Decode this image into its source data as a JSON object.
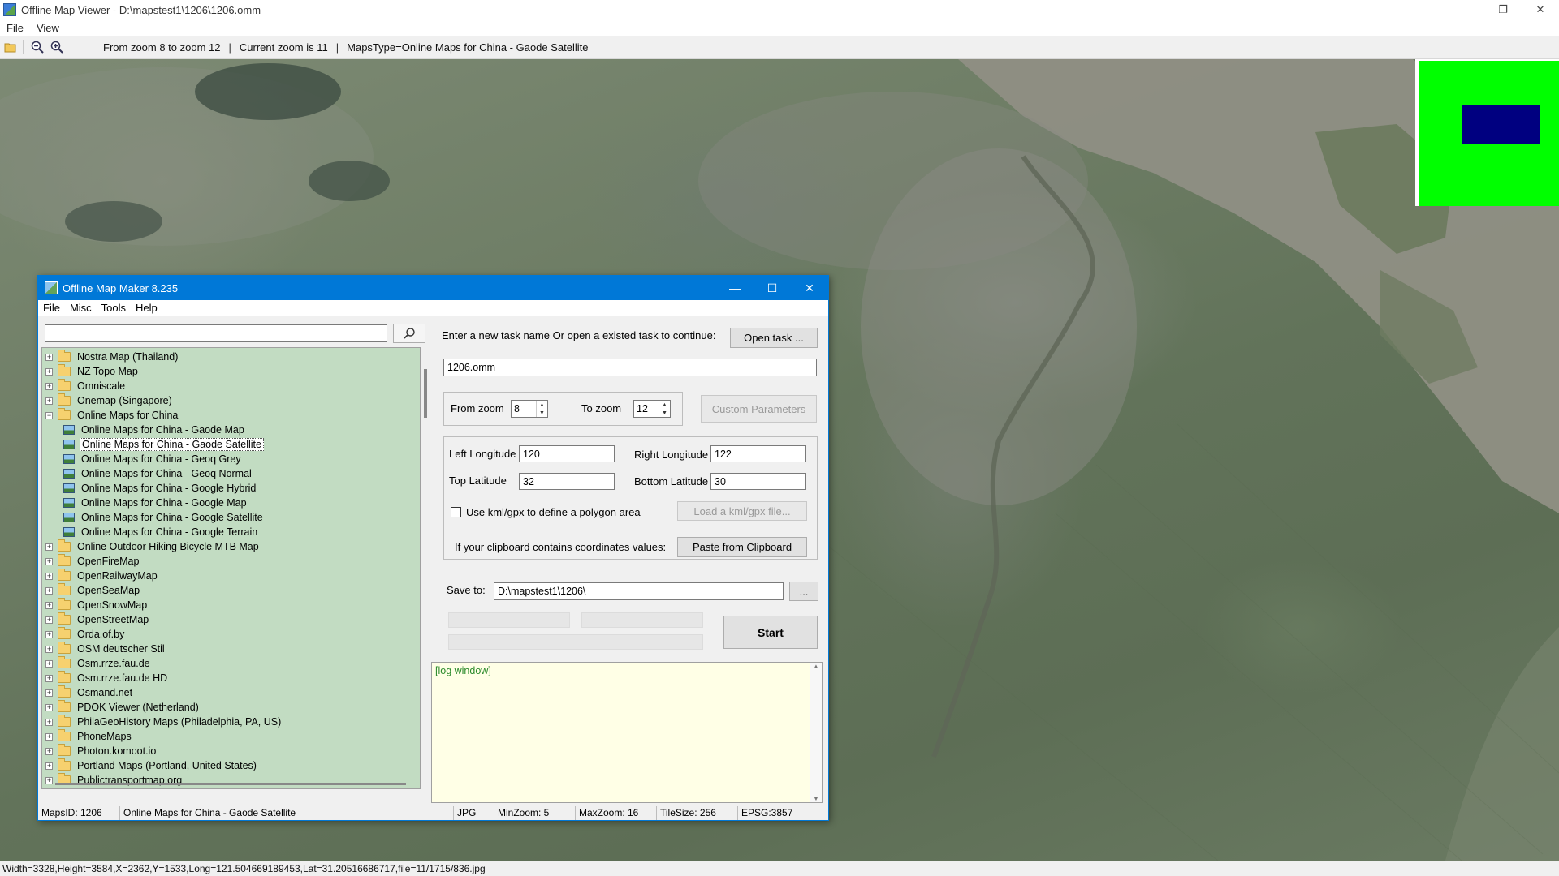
{
  "viewer": {
    "title": "Offline Map Viewer - D:\\mapstest1\\1206\\1206.omm",
    "menu": [
      "File",
      "View"
    ],
    "toolbar": {
      "zoom_range": "From zoom 8 to zoom 12",
      "current_zoom": "Current zoom is 11",
      "maps_type": "MapsType=Online Maps for China - Gaode Satellite"
    },
    "status": "Width=3328,Height=3584,X=2362,Y=1533,Long=121.504669189453,Lat=31.20516686717,file=11/1715/836.jpg",
    "overview_colors": {
      "background": "#00ff00",
      "viewport": "#000080"
    }
  },
  "maker": {
    "title": "Offline Map Maker 8.235",
    "menu": [
      "File",
      "Misc",
      "Tools",
      "Help"
    ],
    "search": {
      "value": "",
      "placeholder": ""
    },
    "tree": [
      {
        "label": "Nostra Map (Thailand)",
        "level": 0,
        "type": "folder",
        "expanded": false
      },
      {
        "label": "NZ Topo Map",
        "level": 0,
        "type": "folder",
        "expanded": false
      },
      {
        "label": "Omniscale",
        "level": 0,
        "type": "folder",
        "expanded": false
      },
      {
        "label": "Onemap (Singapore)",
        "level": 0,
        "type": "folder",
        "expanded": false
      },
      {
        "label": "Online Maps for China",
        "level": 0,
        "type": "folder",
        "expanded": true
      },
      {
        "label": "Online Maps for China - Gaode Map",
        "level": 1,
        "type": "map"
      },
      {
        "label": "Online Maps for China - Gaode Satellite",
        "level": 1,
        "type": "map",
        "selected": true
      },
      {
        "label": "Online Maps for China - Geoq Grey",
        "level": 1,
        "type": "map"
      },
      {
        "label": "Online Maps for China - Geoq Normal",
        "level": 1,
        "type": "map"
      },
      {
        "label": "Online Maps for China - Google Hybrid",
        "level": 1,
        "type": "map"
      },
      {
        "label": "Online Maps for China - Google Map",
        "level": 1,
        "type": "map"
      },
      {
        "label": "Online Maps for China - Google Satellite",
        "level": 1,
        "type": "map"
      },
      {
        "label": "Online Maps for China - Google Terrain",
        "level": 1,
        "type": "map"
      },
      {
        "label": "Online Outdoor Hiking Bicycle MTB Map",
        "level": 0,
        "type": "folder",
        "expanded": false
      },
      {
        "label": "OpenFireMap",
        "level": 0,
        "type": "folder",
        "expanded": false
      },
      {
        "label": "OpenRailwayMap",
        "level": 0,
        "type": "folder",
        "expanded": false
      },
      {
        "label": "OpenSeaMap",
        "level": 0,
        "type": "folder",
        "expanded": false
      },
      {
        "label": "OpenSnowMap",
        "level": 0,
        "type": "folder",
        "expanded": false
      },
      {
        "label": "OpenStreetMap",
        "level": 0,
        "type": "folder",
        "expanded": false
      },
      {
        "label": "Orda.of.by",
        "level": 0,
        "type": "folder",
        "expanded": false
      },
      {
        "label": "OSM deutscher Stil",
        "level": 0,
        "type": "folder",
        "expanded": false
      },
      {
        "label": "Osm.rrze.fau.de",
        "level": 0,
        "type": "folder",
        "expanded": false
      },
      {
        "label": "Osm.rrze.fau.de HD",
        "level": 0,
        "type": "folder",
        "expanded": false
      },
      {
        "label": "Osmand.net",
        "level": 0,
        "type": "folder",
        "expanded": false
      },
      {
        "label": "PDOK Viewer (Netherland)",
        "level": 0,
        "type": "folder",
        "expanded": false
      },
      {
        "label": "PhilaGeoHistory Maps (Philadelphia, PA, US)",
        "level": 0,
        "type": "folder",
        "expanded": false
      },
      {
        "label": "PhoneMaps",
        "level": 0,
        "type": "folder",
        "expanded": false
      },
      {
        "label": "Photon.komoot.io",
        "level": 0,
        "type": "folder",
        "expanded": false
      },
      {
        "label": "Portland Maps (Portland, United States)",
        "level": 0,
        "type": "folder",
        "expanded": false
      },
      {
        "label": "Publictransportmap.org",
        "level": 0,
        "type": "folder",
        "expanded": false
      }
    ],
    "task": {
      "prompt": "Enter a new task name Or open a existed task to continue:",
      "open_btn": "Open task ...",
      "name": "1206.omm"
    },
    "zoom": {
      "from_label": "From zoom",
      "from_value": "8",
      "to_label": "To zoom",
      "to_value": "12",
      "custom_btn": "Custom Parameters"
    },
    "coords": {
      "left_lon_label": "Left Longitude",
      "left_lon": "120",
      "right_lon_label": "Right Longitude",
      "right_lon": "122",
      "top_lat_label": "Top Latitude",
      "top_lat": "32",
      "bottom_lat_label": "Bottom Latitude",
      "bottom_lat": "30",
      "kml_label": "Use kml/gpx to define a polygon area",
      "kml_btn": "Load a kml/gpx file...",
      "clipboard_label": "If your clipboard contains coordinates values:",
      "clipboard_btn": "Paste from Clipboard"
    },
    "save": {
      "label": "Save to:",
      "path": "D:\\mapstest1\\1206\\",
      "browse_btn": "..."
    },
    "start_btn": "Start",
    "log": "[log window]",
    "status": {
      "maps_id": "MapsID: 1206",
      "maps_name": "Online Maps for China - Gaode Satellite",
      "format": "JPG",
      "min_zoom": "MinZoom: 5",
      "max_zoom": "MaxZoom: 16",
      "tile_size": "TileSize: 256",
      "epsg": "EPSG:3857"
    }
  }
}
